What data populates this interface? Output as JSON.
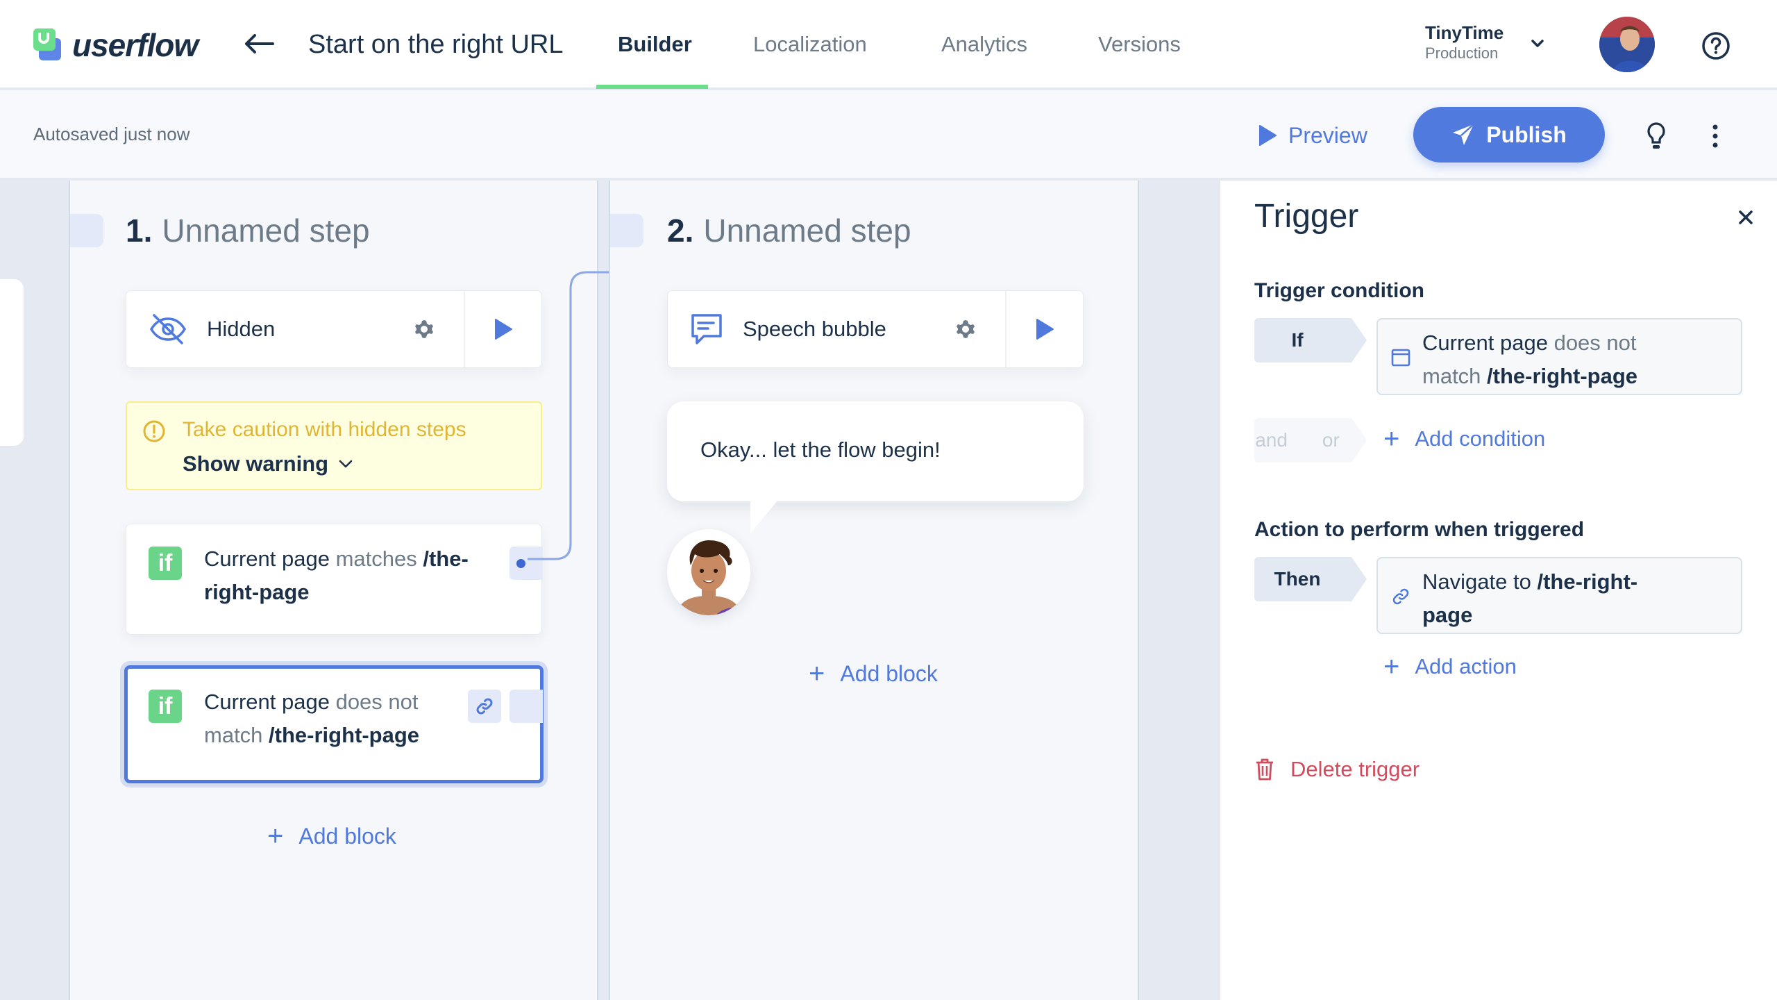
{
  "header": {
    "logo_text": "userflow",
    "flow_title": "Start on the right URL",
    "tabs": [
      {
        "label": "Builder",
        "active": true
      },
      {
        "label": "Localization",
        "active": false
      },
      {
        "label": "Analytics",
        "active": false
      },
      {
        "label": "Versions",
        "active": false
      }
    ],
    "environment": {
      "name": "TinyTime",
      "stage": "Production"
    }
  },
  "toolbar": {
    "autosave_status": "Autosaved just now",
    "preview_label": "Preview",
    "publish_label": "Publish"
  },
  "steps": [
    {
      "number": "1.",
      "name": "Unnamed step",
      "block": {
        "icon": "eye-off-icon",
        "label": "Hidden"
      },
      "warning": {
        "title": "Take caution with hidden steps",
        "toggle_label": "Show warning"
      },
      "conditions": [
        {
          "badge": "if",
          "subject": "Current page",
          "operator": "matches",
          "value": "/the-right-page",
          "selected": false
        },
        {
          "badge": "if",
          "subject": "Current page",
          "operator": "does not match",
          "value": "/the-right-page",
          "selected": true
        }
      ],
      "add_block_label": "Add block"
    },
    {
      "number": "2.",
      "name": "Unnamed step",
      "block": {
        "icon": "speech-bubble-icon",
        "label": "Speech bubble"
      },
      "bubble_text": "Okay... let the flow begin!",
      "add_block_label": "Add block"
    }
  ],
  "trigger_panel": {
    "title": "Trigger",
    "condition_heading": "Trigger condition",
    "if_label": "If",
    "condition": {
      "subject": "Current page",
      "operator": "does not",
      "operator2": "match",
      "value": "/the-right-page"
    },
    "and_label": "and",
    "or_label": "or",
    "add_condition_label": "Add condition",
    "action_heading": "Action to perform when triggered",
    "then_label": "Then",
    "action": {
      "verb": "Navigate to",
      "value": "/the-right-",
      "value2": "page"
    },
    "add_action_label": "Add action",
    "delete_label": "Delete trigger"
  },
  "colors": {
    "accent": "#517ade",
    "brand_green": "#6ade8a",
    "warning": "#dfb533",
    "danger": "#d24b5c"
  }
}
